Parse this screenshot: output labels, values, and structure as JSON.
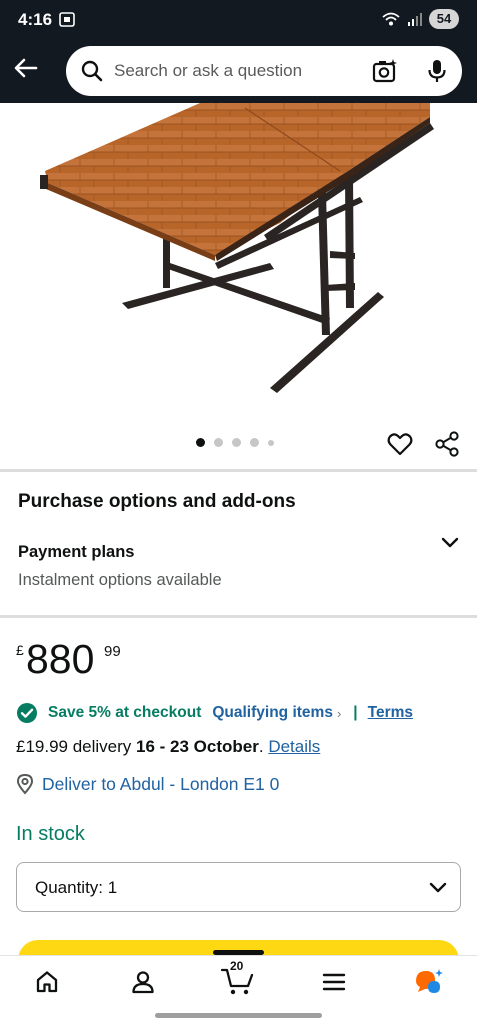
{
  "status_bar": {
    "time": "4:16",
    "battery": "54"
  },
  "search": {
    "placeholder": "Search or ask a question"
  },
  "product": {
    "carousel": {
      "count": 5,
      "active_index": 0
    }
  },
  "purchase_options": {
    "title": "Purchase options and add-ons",
    "payment_plans_label": "Payment plans",
    "instalment_text": "Instalment options available"
  },
  "price": {
    "currency_symbol": "£",
    "whole": "880",
    "fraction": "99"
  },
  "promo": {
    "save_text": "Save 5% at checkout",
    "qualifying_link": "Qualifying items",
    "qualifying_chevron": "›",
    "separator": "|",
    "terms_link": "Terms"
  },
  "delivery": {
    "cost_text": "£19.99 delivery ",
    "dates": "16 - 23 October",
    "period": ". ",
    "details_link": "Details"
  },
  "deliver_to": "Deliver to Abdul - London E1 0",
  "stock_status": "In stock",
  "quantity": {
    "label": "Quantity: 1"
  },
  "bottom_nav": {
    "cart_count": "20"
  },
  "colors": {
    "header_bg": "#131921",
    "link_blue": "#2162a1",
    "success_green": "#067d62",
    "buy_yellow": "#ffd814",
    "wood": "#b8652a",
    "frame": "#2a2522"
  },
  "icons": [
    "back-arrow-icon",
    "search-icon",
    "camera-lens-icon",
    "microphone-icon",
    "heart-icon",
    "share-icon",
    "chevron-down-icon",
    "check-circle-icon",
    "location-pin-icon",
    "home-icon",
    "profile-icon",
    "cart-icon",
    "menu-icon",
    "rufus-assistant-icon"
  ]
}
